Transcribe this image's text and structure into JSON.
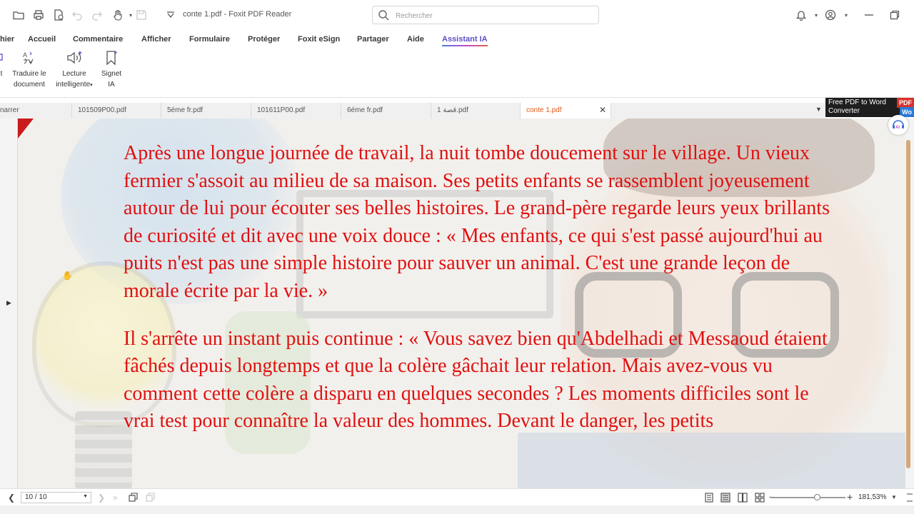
{
  "window": {
    "title": "conte 1.pdf - Foxit PDF Reader"
  },
  "search": {
    "placeholder": "Rechercher"
  },
  "menu": {
    "items": [
      {
        "label": "hier"
      },
      {
        "label": "Accueil"
      },
      {
        "label": "Commentaire"
      },
      {
        "label": "Afficher"
      },
      {
        "label": "Formulaire"
      },
      {
        "label": "Protéger"
      },
      {
        "label": "Foxit eSign"
      },
      {
        "label": "Partager"
      },
      {
        "label": "Aide"
      },
      {
        "label": "Assistant IA",
        "active": true
      }
    ]
  },
  "ribbon": {
    "buttons": [
      {
        "label_1": "t",
        "label_2": ""
      },
      {
        "label_1": "Traduire le",
        "label_2": "document"
      },
      {
        "label_1": "Lecture",
        "label_2": "intelligente"
      },
      {
        "label_1": "Signet",
        "label_2": "IA"
      }
    ]
  },
  "tabs": [
    {
      "label": "narrer"
    },
    {
      "label": "101509P00.pdf"
    },
    {
      "label": "5éme fr.pdf"
    },
    {
      "label": "101611P00.pdf"
    },
    {
      "label": "6éme fr.pdf"
    },
    {
      "label": "1 قصة.pdf"
    },
    {
      "label": "conte 1.pdf",
      "active": true
    }
  ],
  "promo": {
    "line_1": "Free PDF to Word",
    "line_2": "Converter",
    "badge_pdf": "PDF",
    "badge_wo": "Wo"
  },
  "document": {
    "paragraphs": [
      "Après une longue journée de travail, la nuit tombe doucement sur le village. Un vieux fermier s'assoit au milieu de sa maison. Ses petits enfants se rassemblent joyeusement autour de lui pour écouter ses belles histoires. Le grand-père regarde leurs yeux brillants de curiosité et dit avec une voix douce : « Mes enfants, ce qui s'est passé aujourd'hui au puits n'est pas une simple histoire pour sauver un animal. C'est une grande leçon de morale écrite par la vie. »",
      "Il s'arrête un instant puis continue : « Vous savez bien qu'Abdelhadi et Messaoud étaient fâchés depuis longtemps et que la colère gâchait leur relation. Mais avez-vous vu comment cette colère a disparu en quelques secondes ? Les moments difficiles sont le vrai test pour connaître la valeur des hommes. Devant le danger, les petits"
    ],
    "text_color": "#e01010"
  },
  "ai_float": {
    "label": "AI"
  },
  "status": {
    "page_indicator": "10 / 10",
    "zoom": "181,53%",
    "zoom_fraction": 0.62
  }
}
